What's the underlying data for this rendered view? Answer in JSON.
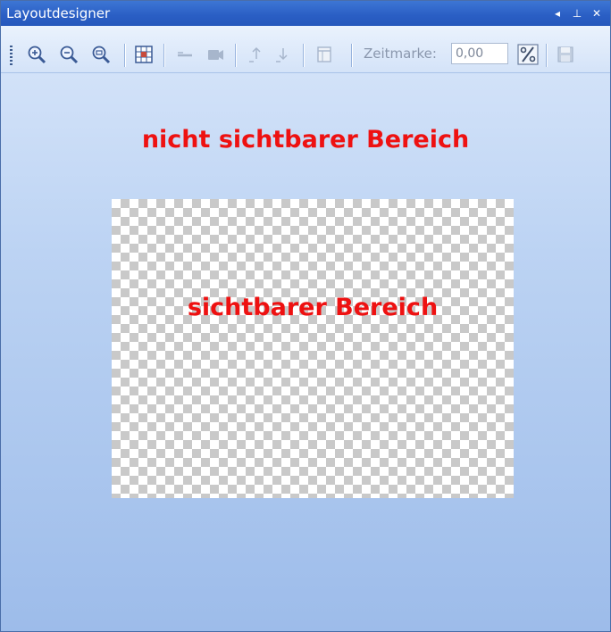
{
  "window": {
    "title": "Layoutdesigner",
    "controls": [
      "◂",
      "⊥",
      "✕"
    ]
  },
  "toolbar": {
    "buttons": [
      {
        "icon": "zoom-in-icon"
      },
      {
        "icon": "zoom-out-icon"
      },
      {
        "icon": "zoom-fit-icon"
      },
      {
        "icon": "grid-icon"
      },
      {
        "icon": "line-icon"
      },
      {
        "icon": "video-icon"
      },
      {
        "icon": "align-up-icon"
      },
      {
        "icon": "align-down-icon"
      },
      {
        "icon": "layer-icon"
      },
      {
        "icon": "percent-icon"
      },
      {
        "icon": "save-icon"
      }
    ],
    "zeitmarke_label": "Zeitmarke:",
    "zeitmarke_value": "0,00"
  },
  "canvas": {
    "outer_label": "nicht sichtbarer Bereich",
    "inner_label": "sichtbarer Bereich"
  },
  "colors": {
    "title_bar": "#2a5ec4",
    "area_text": "#ee1111",
    "toolbar_icon": "#3a5a95"
  }
}
